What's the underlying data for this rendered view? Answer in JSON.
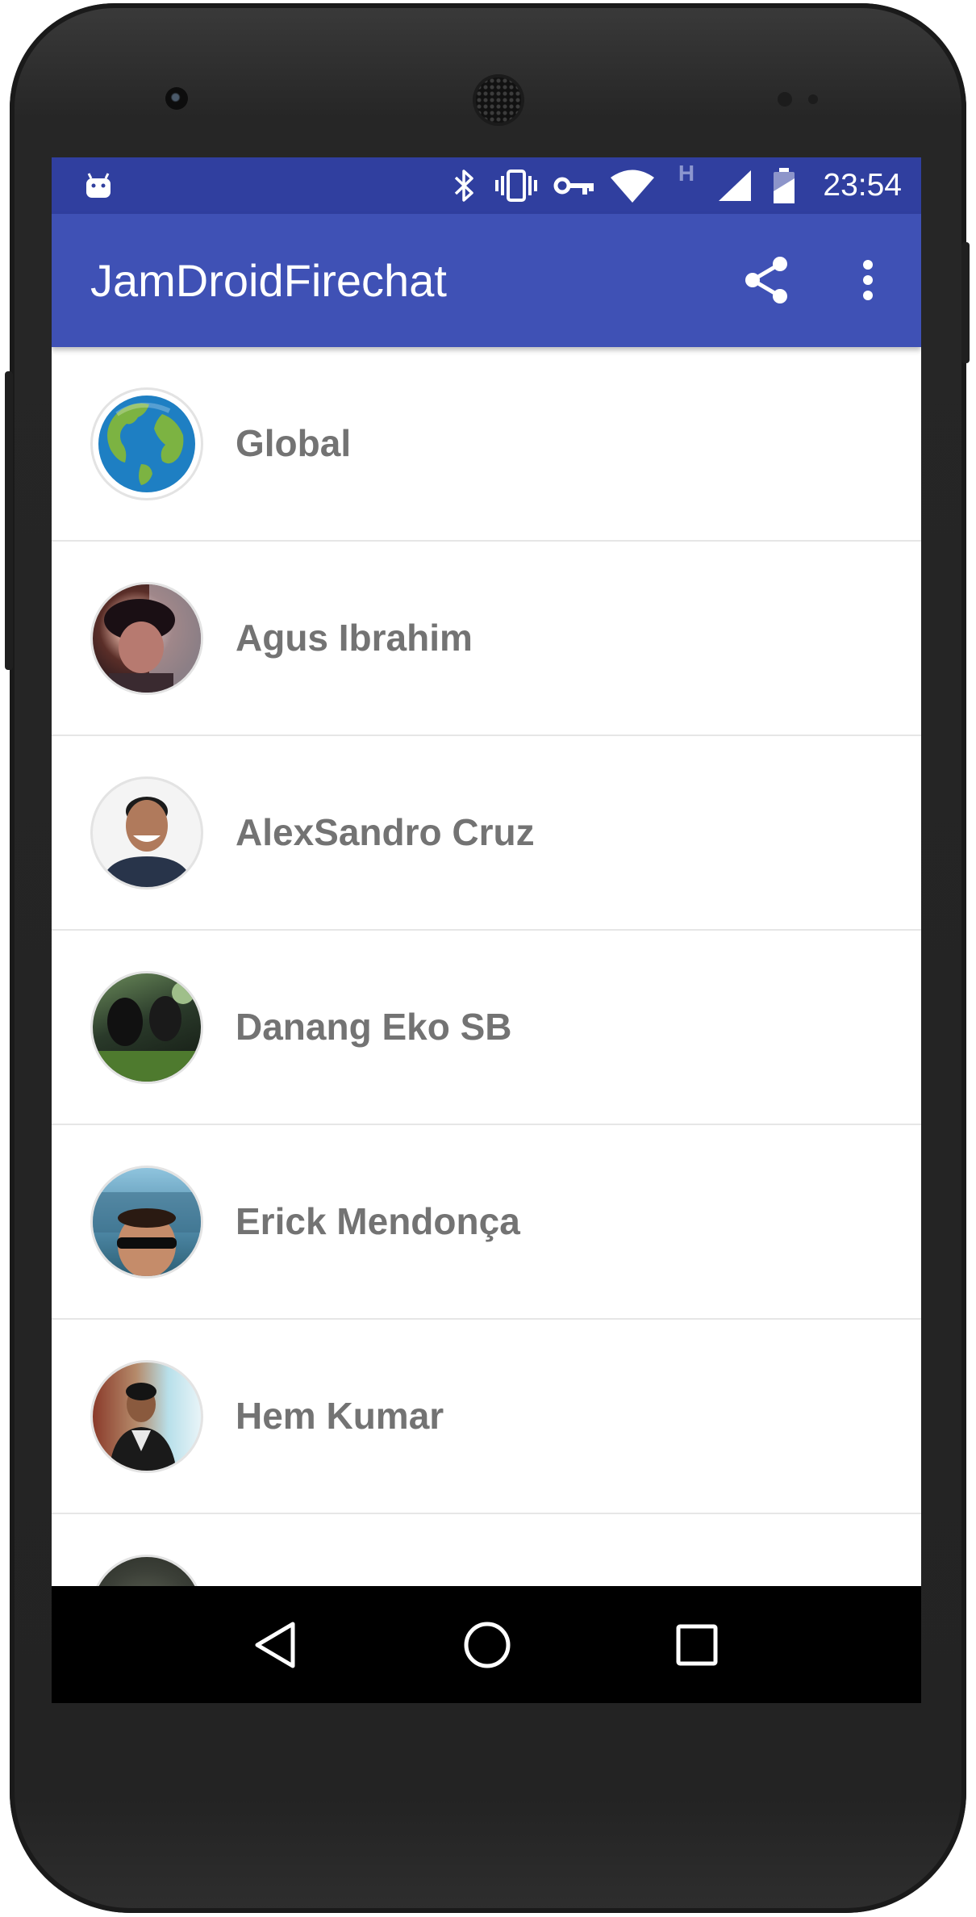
{
  "app": {
    "title": "JamDroidFirechat"
  },
  "status_bar": {
    "time": "23:54",
    "network_type": "H",
    "icons": [
      "android-debug-icon",
      "bluetooth-icon",
      "vibrate-icon",
      "vpn-key-icon",
      "wifi-icon",
      "cell-signal-icon",
      "battery-icon"
    ]
  },
  "toolbar": {
    "share_icon": "share-icon",
    "menu_icon": "more-vert-icon"
  },
  "contacts": [
    {
      "name": "Global",
      "avatar": "globe-icon"
    },
    {
      "name": "Agus Ibrahim",
      "avatar": "user-photo"
    },
    {
      "name": "AlexSandro Cruz",
      "avatar": "user-photo"
    },
    {
      "name": "Danang Eko SB",
      "avatar": "user-photo"
    },
    {
      "name": "Erick Mendonça",
      "avatar": "user-photo"
    },
    {
      "name": "Hem Kumar",
      "avatar": "user-photo"
    }
  ],
  "navigation": {
    "back": "back-triangle-icon",
    "home": "home-circle-icon",
    "recents": "recents-square-icon"
  },
  "colors": {
    "status_bar": "#303f9f",
    "app_bar": "#3f51b5",
    "name_text": "#737373",
    "divider": "#e6e6e6"
  }
}
